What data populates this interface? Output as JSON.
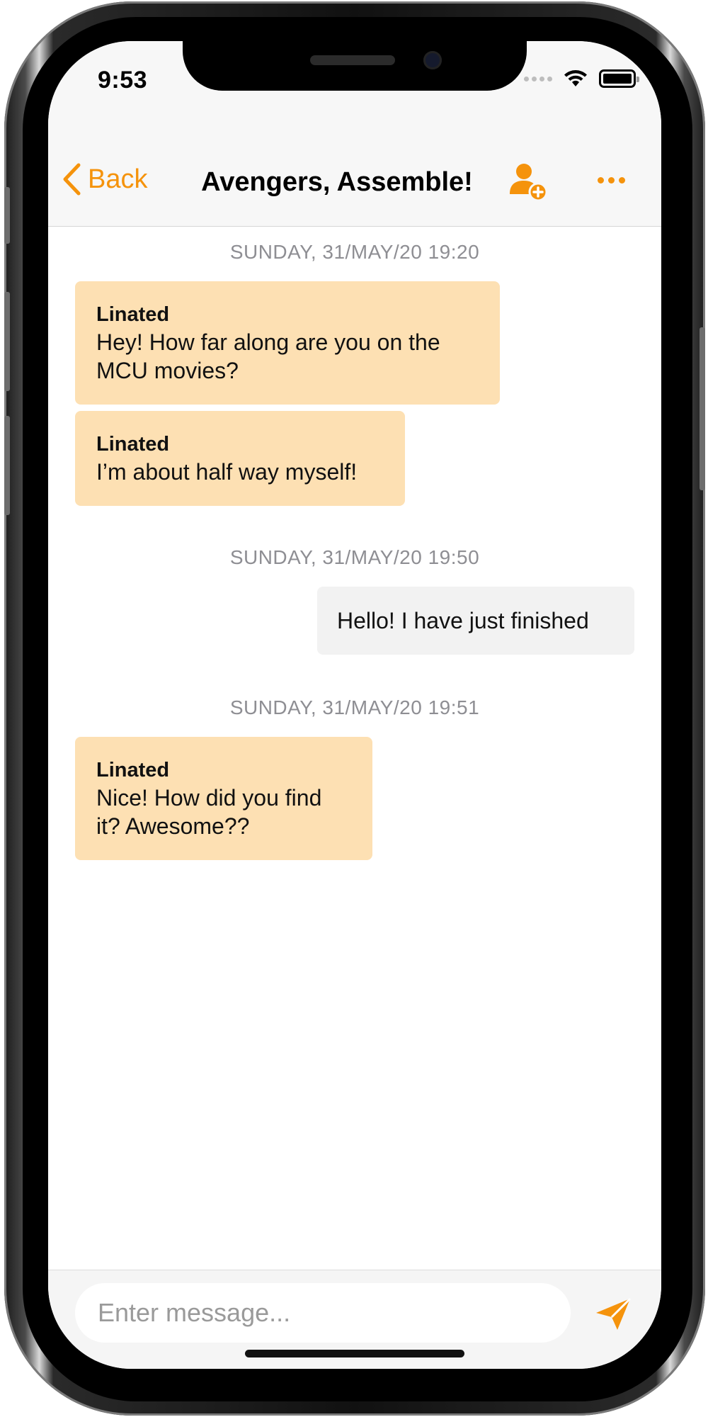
{
  "status_bar": {
    "time": "9:53"
  },
  "nav": {
    "back_label": "Back",
    "title": "Avengers, Assemble!",
    "add_member_icon": "person-add-icon",
    "more_icon": "ellipsis-icon"
  },
  "messages": [
    {
      "type": "timestamp",
      "text": "SUNDAY, 31/MAY/20 19:20"
    },
    {
      "type": "incoming",
      "sender": "Linated",
      "lines": [
        "Hey! How far along are you on the",
        "MCU movies?"
      ]
    },
    {
      "type": "incoming",
      "sender": "Linated",
      "lines": [
        "I’m about half way myself!"
      ]
    },
    {
      "type": "timestamp",
      "text": "SUNDAY, 31/MAY/20 19:50"
    },
    {
      "type": "outgoing",
      "lines": [
        "Hello! I have just finished"
      ]
    },
    {
      "type": "timestamp",
      "text": "SUNDAY, 31/MAY/20 19:51"
    },
    {
      "type": "incoming",
      "sender": "Linated",
      "lines": [
        "Nice! How did you find",
        "it? Awesome??"
      ]
    }
  ],
  "composer": {
    "placeholder": "Enter message...",
    "send_icon": "paper-plane-icon"
  },
  "colors": {
    "accent": "#f5930c",
    "incoming_bubble": "#fde0b3",
    "outgoing_bubble": "#f2f2f2"
  }
}
